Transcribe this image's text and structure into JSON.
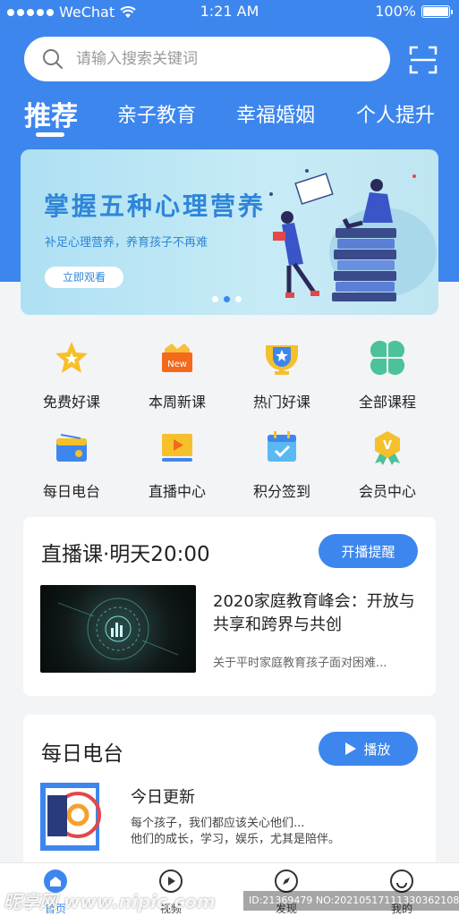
{
  "status_bar": {
    "carrier": "WeChat",
    "time": "1:21 AM",
    "battery": "100%"
  },
  "search": {
    "placeholder": "请输入搜索关键词"
  },
  "tabs": [
    {
      "label": "推荐",
      "active": true
    },
    {
      "label": "亲子教育",
      "active": false
    },
    {
      "label": "幸福婚姻",
      "active": false
    },
    {
      "label": "个人提升",
      "active": false
    }
  ],
  "banner": {
    "title": "掌握五种心理营养",
    "subtitle": "补足心理营养，养育孩子不再难",
    "button": "立即观看",
    "active_dot": 2
  },
  "grid": [
    {
      "label": "免费好课",
      "icon": "star-icon"
    },
    {
      "label": "本周新课",
      "icon": "new-badge-icon"
    },
    {
      "label": "热门好课",
      "icon": "trophy-icon"
    },
    {
      "label": "全部课程",
      "icon": "clover-icon"
    },
    {
      "label": "每日电台",
      "icon": "radio-icon"
    },
    {
      "label": "直播中心",
      "icon": "live-play-icon"
    },
    {
      "label": "积分签到",
      "icon": "calendar-check-icon"
    },
    {
      "label": "会员中心",
      "icon": "vip-medal-icon"
    }
  ],
  "live": {
    "title": "直播课·明天20:00",
    "button": "开播提醒",
    "item_title": "2020家庭教育峰会：开放与共享和跨界与共创",
    "item_desc": "关于平时家庭教育孩子面对困难..."
  },
  "radio": {
    "title": "每日电台",
    "button": "播放",
    "today": "今日更新",
    "desc_line1": "每个孩子，我们都应该关心他们...",
    "desc_line2": "他们的成长，学习，娱乐，尤其是陪伴。"
  },
  "tabbar": [
    {
      "label": "首页",
      "icon": "home-icon",
      "active": true
    },
    {
      "label": "视频",
      "icon": "play-circle-icon",
      "active": false
    },
    {
      "label": "发现",
      "icon": "compass-icon",
      "active": false
    },
    {
      "label": "我的",
      "icon": "smile-icon",
      "active": false
    }
  ],
  "watermark": {
    "left": "昵享网 www.nipic.com",
    "right": "ID:21369479 NO:20210517111330362108"
  },
  "colors": {
    "primary": "#3d86ee",
    "banner_text": "#2f86d8",
    "background": "#f3f4f6"
  }
}
